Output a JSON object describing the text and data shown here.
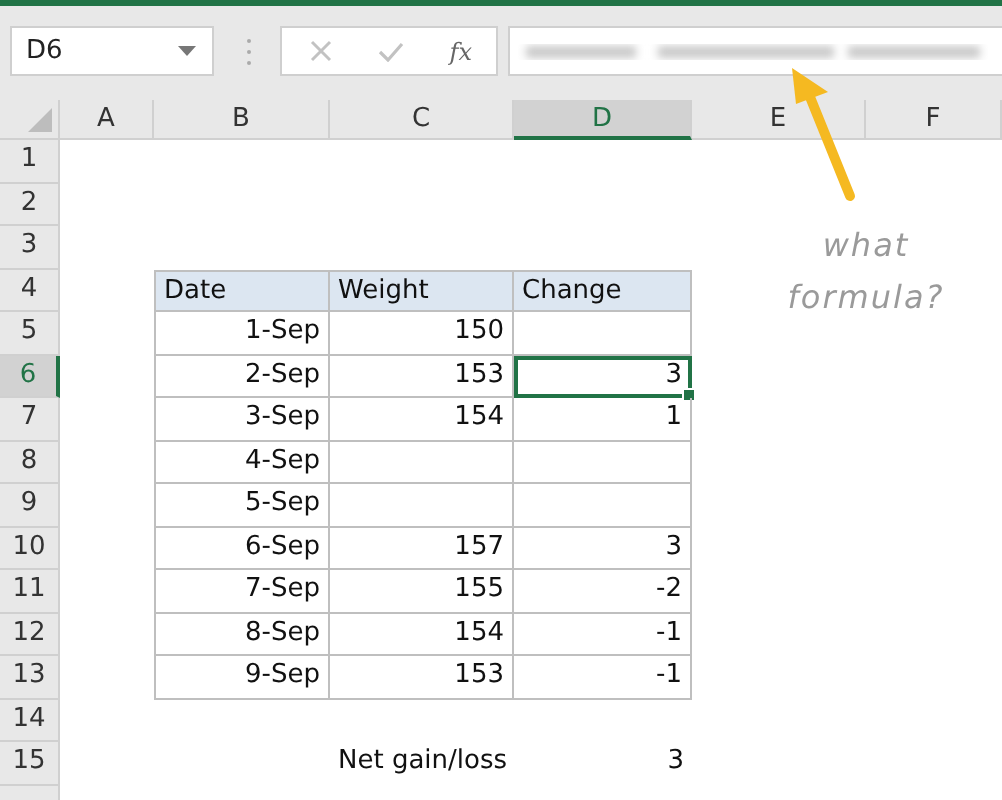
{
  "name_box": {
    "value": "D6"
  },
  "formula_bar": {
    "fx_label": "fx"
  },
  "columns": [
    {
      "label": "A",
      "selected": false
    },
    {
      "label": "B",
      "selected": false
    },
    {
      "label": "C",
      "selected": false
    },
    {
      "label": "D",
      "selected": true
    },
    {
      "label": "E",
      "selected": false
    },
    {
      "label": "F",
      "selected": false
    }
  ],
  "rows": [
    {
      "label": "1",
      "selected": false
    },
    {
      "label": "2",
      "selected": false
    },
    {
      "label": "3",
      "selected": false
    },
    {
      "label": "4",
      "selected": false
    },
    {
      "label": "5",
      "selected": false
    },
    {
      "label": "6",
      "selected": true
    },
    {
      "label": "7",
      "selected": false
    },
    {
      "label": "8",
      "selected": false
    },
    {
      "label": "9",
      "selected": false
    },
    {
      "label": "10",
      "selected": false
    },
    {
      "label": "11",
      "selected": false
    },
    {
      "label": "12",
      "selected": false
    },
    {
      "label": "13",
      "selected": false
    },
    {
      "label": "14",
      "selected": false
    },
    {
      "label": "15",
      "selected": false
    }
  ],
  "table": {
    "headers": [
      "Date",
      "Weight",
      "Change"
    ],
    "rows": [
      {
        "date": "1-Sep",
        "weight": "150",
        "selected": false
      },
      {
        "date": "2-Sep",
        "weight": "153",
        "change": "3",
        "selected": true
      },
      {
        "date": "3-Sep",
        "weight": "154",
        "change": "1",
        "selected": false
      },
      {
        "date": "4-Sep",
        "selected": false
      },
      {
        "date": "5-Sep",
        "selected": false
      },
      {
        "date": "6-Sep",
        "weight": "157",
        "change": "3",
        "selected": false
      },
      {
        "date": "7-Sep",
        "weight": "155",
        "change": "-2",
        "selected": false
      },
      {
        "date": "8-Sep",
        "weight": "154",
        "change": "-1",
        "selected": false
      },
      {
        "date": "9-Sep",
        "weight": "153",
        "change": "-1",
        "selected": false
      }
    ]
  },
  "summary": {
    "label": "Net gain/loss",
    "value": "3"
  },
  "annotation": {
    "text": "what formula?"
  }
}
